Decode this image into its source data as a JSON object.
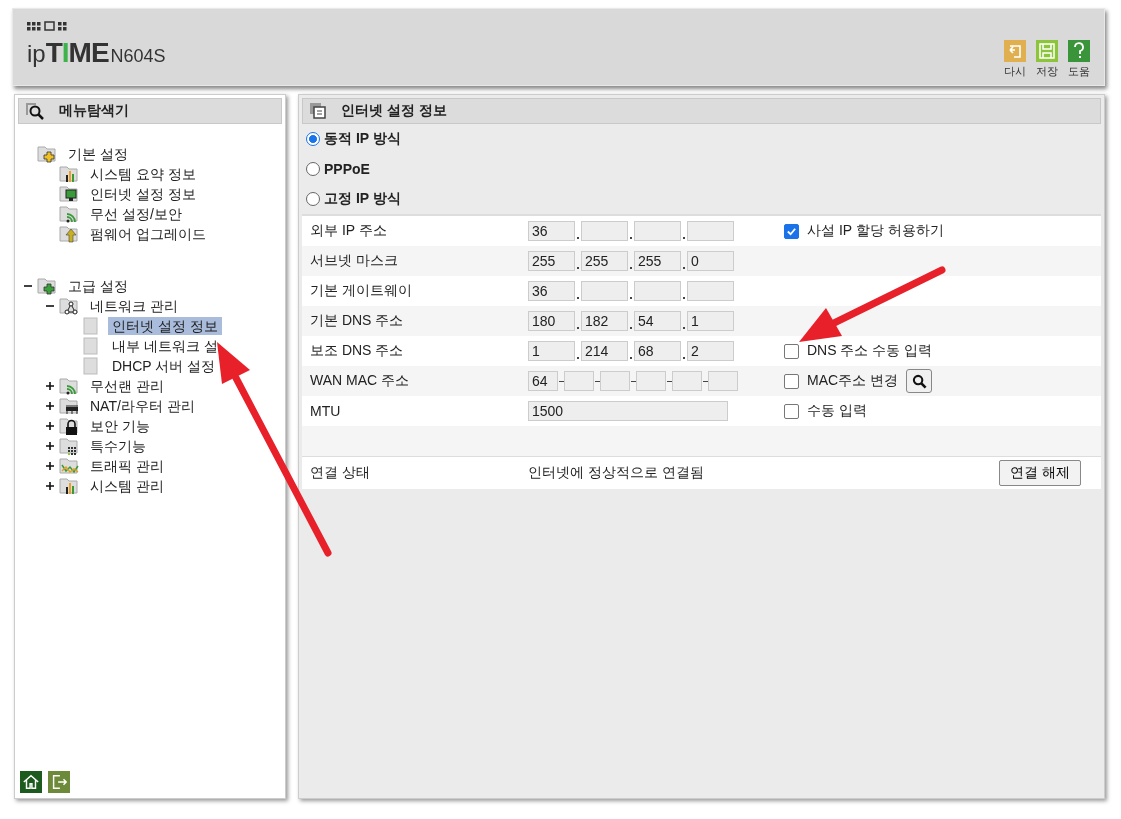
{
  "header": {
    "brand": "ipTIME",
    "model": "N604S",
    "tools": [
      {
        "label": "다시",
        "kind": "undo"
      },
      {
        "label": "저장",
        "kind": "save"
      },
      {
        "label": "도움",
        "kind": "help"
      }
    ]
  },
  "menu": {
    "title": "메뉴탐색기",
    "items": [
      {
        "label": "기본 설정",
        "kind": "folder-plus-gold",
        "children": [
          {
            "label": "시스템 요약 정보",
            "kind": "chart",
            "selected": false
          },
          {
            "label": "인터넷 설정 정보",
            "kind": "monitor",
            "selected": false
          },
          {
            "label": "무선 설정/보안",
            "kind": "wifi",
            "selected": false
          },
          {
            "label": "펌웨어 업그레이드",
            "kind": "upgrade",
            "selected": false
          }
        ]
      },
      {
        "label": "고급 설정",
        "kind": "folder-plus-green",
        "expanded": true,
        "children": [
          {
            "label": "네트워크 관리",
            "kind": "network",
            "expanded": true,
            "children": [
              {
                "label": "인터넷 설정 정보",
                "kind": "page",
                "selected": true
              },
              {
                "label": "내부 네트워크 설",
                "kind": "page",
                "selected": false
              },
              {
                "label": "DHCP 서버 설정",
                "kind": "page",
                "selected": false
              }
            ]
          },
          {
            "label": "무선랜 관리",
            "kind": "wifi",
            "expanded": false
          },
          {
            "label": "NAT/라우터 관리",
            "kind": "router",
            "expanded": false
          },
          {
            "label": "보안 기능",
            "kind": "lock",
            "expanded": false
          },
          {
            "label": "특수기능",
            "kind": "dots",
            "expanded": false
          },
          {
            "label": "트래픽 관리",
            "kind": "traffic",
            "expanded": false
          },
          {
            "label": "시스템 관리",
            "kind": "chart",
            "expanded": false
          }
        ]
      }
    ]
  },
  "panel": {
    "title": "인터넷 설정 정보",
    "radios": [
      {
        "label": "동적 IP 방식",
        "selected": true
      },
      {
        "label": "PPPoE",
        "selected": false
      },
      {
        "label": "고정 IP 방식",
        "selected": false
      }
    ],
    "rows": [
      {
        "label": "외부 IP 주소",
        "kind": "ip",
        "values": [
          "36"
        ],
        "option": {
          "label": "사설 IP 할당 허용하기",
          "checked": true
        }
      },
      {
        "label": "서브넷 마스크",
        "kind": "ip",
        "values": [
          "255",
          "255",
          "255",
          "0"
        ]
      },
      {
        "label": "기본 게이트웨이",
        "kind": "ip",
        "values": [
          "36"
        ]
      },
      {
        "label": "기본 DNS 주소",
        "kind": "ip",
        "values": [
          "180",
          "182",
          "54",
          "1"
        ]
      },
      {
        "label": "보조 DNS 주소",
        "kind": "ip",
        "values": [
          "1",
          "214",
          "68",
          "2"
        ],
        "option": {
          "label": "DNS 주소 수동 입력",
          "checked": false
        }
      },
      {
        "label": "WAN MAC 주소",
        "kind": "mac",
        "values": [
          "64"
        ],
        "option": {
          "label": "MAC주소 변경",
          "checked": false,
          "search": true
        }
      },
      {
        "label": "MTU",
        "kind": "text",
        "values": [
          "1500"
        ],
        "option": {
          "label": "수동 입력",
          "checked": false
        }
      }
    ],
    "status": {
      "label": "연결 상태",
      "value": "인터넷에 정상적으로 연결됨",
      "button": "연결 해제"
    }
  }
}
